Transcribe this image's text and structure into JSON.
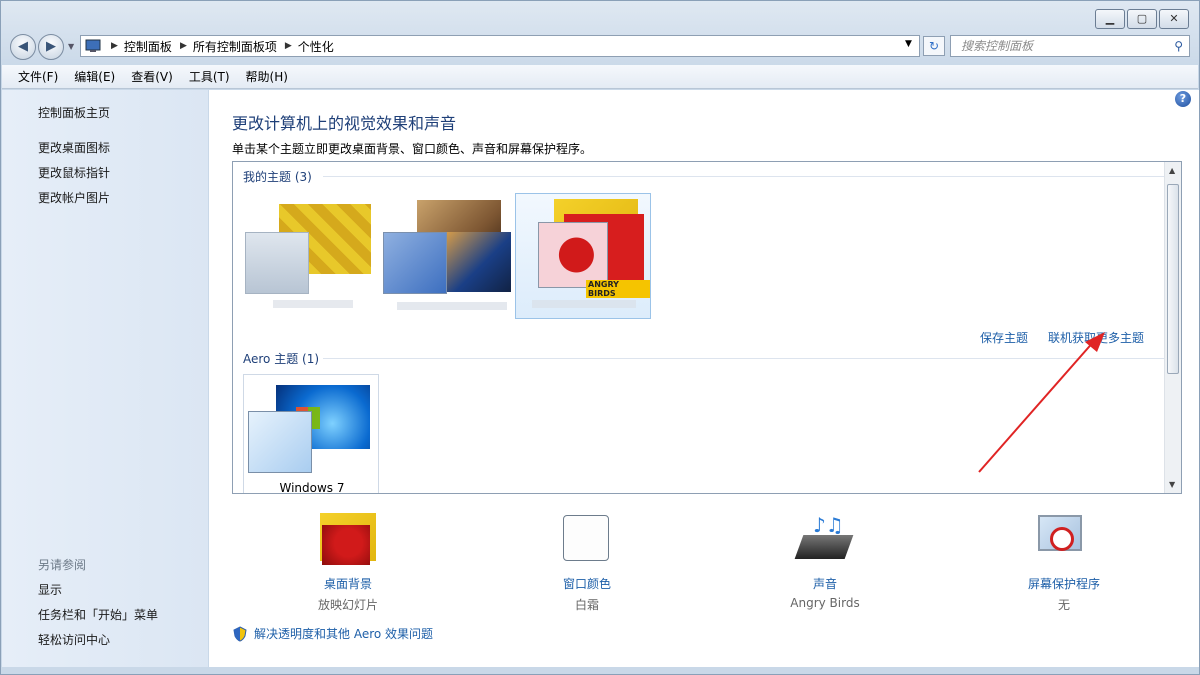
{
  "address": {
    "segments": [
      "控制面板",
      "所有控制面板项",
      "个性化"
    ]
  },
  "search": {
    "placeholder": "搜索控制面板"
  },
  "menu": [
    "文件(F)",
    "编辑(E)",
    "查看(V)",
    "工具(T)",
    "帮助(H)"
  ],
  "sidebar": {
    "top_links": [
      "控制面板主页",
      "更改桌面图标",
      "更改鼠标指针",
      "更改帐户图片"
    ],
    "see_also_header": "另请参阅",
    "see_also_links": [
      "显示",
      "任务栏和「开始」菜单",
      "轻松访问中心"
    ]
  },
  "main": {
    "title": "更改计算机上的视觉效果和声音",
    "subtitle": "单击某个主题立即更改桌面背景、窗口颜色、声音和屏幕保护程序。",
    "my_themes_header": "我的主题 (3)",
    "save_theme": "保存主题",
    "get_more_themes": "联机获取更多主题",
    "aero_header": "Aero 主题 (1)",
    "aero_theme_name": "Windows 7",
    "angry_birds_badge": "ANGRY BIRDS",
    "troubleshoot_link": "解决透明度和其他 Aero 效果问题"
  },
  "options": [
    {
      "label": "桌面背景",
      "sub": "放映幻灯片"
    },
    {
      "label": "窗口颜色",
      "sub": "白霜"
    },
    {
      "label": "声音",
      "sub": "Angry Birds"
    },
    {
      "label": "屏幕保护程序",
      "sub": "无"
    }
  ],
  "colors": {
    "link": "#1e5fa8",
    "annotation_arrow": "#e02424"
  }
}
